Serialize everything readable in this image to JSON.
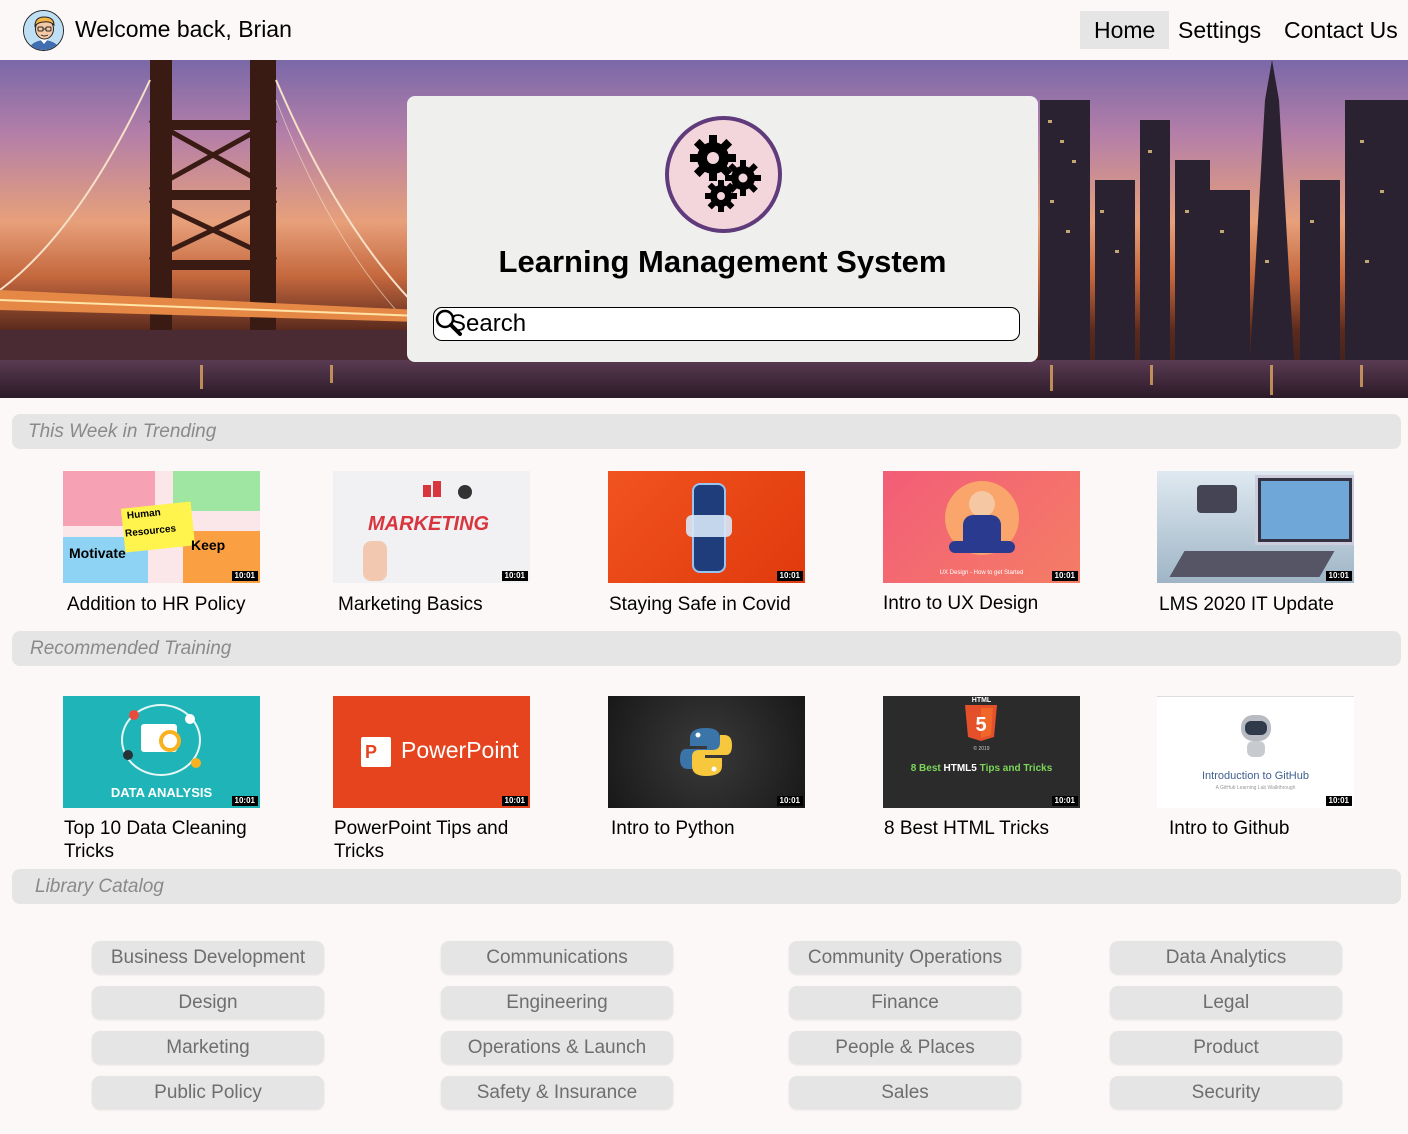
{
  "header": {
    "welcome": "Welcome back, Brian",
    "nav": [
      {
        "label": "Home",
        "active": true
      },
      {
        "label": "Settings",
        "active": false
      },
      {
        "label": "Contact Us",
        "active": false
      }
    ]
  },
  "hero": {
    "title": "Learning Management System",
    "search_placeholder": "Search",
    "logo_icon": "gears-icon"
  },
  "sections": {
    "trending": "This Week in Trending",
    "recommended": "Recommended Training",
    "catalog": "Library Catalog"
  },
  "trending": [
    {
      "title": "Addition to HR Policy",
      "duration": "10:01",
      "thumb_text": [
        "Human",
        "Resources",
        "Motivate",
        "Keep"
      ]
    },
    {
      "title": "Marketing Basics",
      "duration": "10:01",
      "thumb_text": [
        "MARKETING"
      ]
    },
    {
      "title": "Staying Safe in Covid",
      "duration": "10:01"
    },
    {
      "title": "Intro to UX Design",
      "duration": "10:01",
      "thumb_text": [
        "UX Design - How to get Started"
      ]
    },
    {
      "title": "LMS 2020 IT Update",
      "duration": "10:01"
    }
  ],
  "recommended": [
    {
      "title": "Top 10 Data Cleaning Tricks",
      "duration": "10:01",
      "thumb_text": [
        "DATA ANALYSIS"
      ]
    },
    {
      "title": "PowerPoint Tips and Tricks",
      "duration": "10:01",
      "thumb_text": [
        "PowerPoint"
      ]
    },
    {
      "title": "Intro to Python",
      "duration": "10:01"
    },
    {
      "title": "8 Best HTML Tricks",
      "duration": "10:01",
      "thumb_text": [
        "HTML",
        "© 2019",
        "8 Best",
        "HTML5",
        "Tips and Tricks"
      ]
    },
    {
      "title": "Intro to Github",
      "duration": "10:01",
      "thumb_text": [
        "Introduction to GitHub",
        "A GitHub Learning Lab Walkthrough"
      ]
    }
  ],
  "catalog": [
    [
      "Business Development",
      "Communications",
      "Community Operations",
      "Data Analytics"
    ],
    [
      "Design",
      "Engineering",
      "Finance",
      "Legal"
    ],
    [
      "Marketing",
      "Operations & Launch",
      "People & Places",
      "Product"
    ],
    [
      "Public Policy",
      "Safety & Insurance",
      "Sales",
      "Security"
    ]
  ]
}
